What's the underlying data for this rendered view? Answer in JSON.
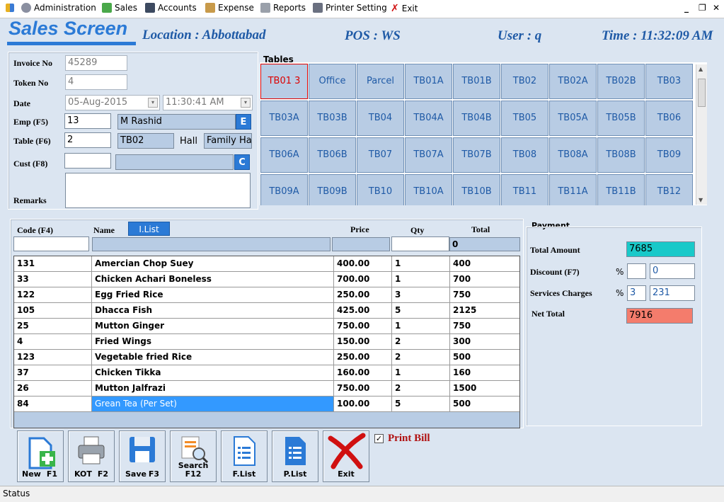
{
  "menu": {
    "administration": "Administration",
    "sales": "Sales",
    "accounts": "Accounts",
    "expense": "Expense",
    "reports": "Reports",
    "printer_setting": "Printer Setting",
    "exit": "Exit"
  },
  "header": {
    "title": "Sales Screen",
    "location": "Location : Abbottabad",
    "pos": "POS : WS",
    "user": "User : q",
    "time": "Time : 11:32:09 AM"
  },
  "form": {
    "invoice_label": "Invoice No",
    "invoice_value": "45289",
    "token_label": "Token No",
    "token_value": "4",
    "date_label": "Date",
    "date_value": "05-Aug-2015",
    "time_value": "11:30:41 AM",
    "emp_label": "Emp (F5)",
    "emp_code": "13",
    "emp_name": "M Rashid",
    "emp_btn": "E",
    "table_label": "Table (F6)",
    "table_code": "2",
    "table_name": "TB02",
    "hall_label": "Hall",
    "hall_value": "Family Ha",
    "cust_label": "Cust (F8)",
    "cust_code": "",
    "cust_name": "",
    "cust_btn": "C",
    "remarks_label": "Remarks",
    "remarks_value": ""
  },
  "tables": {
    "label": "Tables",
    "items": [
      "TB01  3",
      "Office",
      "Parcel",
      "TB01A",
      "TB01B",
      "TB02",
      "TB02A",
      "TB02B",
      "TB03",
      "TB03A",
      "TB03B",
      "TB04",
      "TB04A",
      "TB04B",
      "TB05",
      "TB05A",
      "TB05B",
      "TB06",
      "TB06A",
      "TB06B",
      "TB07",
      "TB07A",
      "TB07B",
      "TB08",
      "TB08A",
      "TB08B",
      "TB09",
      "TB09A",
      "TB09B",
      "TB10",
      "TB10A",
      "TB10B",
      "TB11",
      "TB11A",
      "TB11B",
      "TB12"
    ]
  },
  "grid": {
    "headers": {
      "code": "Code (F4)",
      "name": "Name",
      "ilist": "I.List",
      "price": "Price",
      "qty": "Qty",
      "total": "Total"
    },
    "entry_total": "0",
    "rows": [
      {
        "code": "131",
        "name": "Amercian Chop Suey",
        "price": "400.00",
        "qty": "1",
        "total": "400"
      },
      {
        "code": "33",
        "name": "Chicken Achari Boneless",
        "price": "700.00",
        "qty": "1",
        "total": "700"
      },
      {
        "code": "122",
        "name": "Egg Fried Rice",
        "price": "250.00",
        "qty": "3",
        "total": "750"
      },
      {
        "code": "105",
        "name": "Dhacca Fish",
        "price": "425.00",
        "qty": "5",
        "total": "2125"
      },
      {
        "code": "25",
        "name": "Mutton Ginger",
        "price": "750.00",
        "qty": "1",
        "total": "750"
      },
      {
        "code": "4",
        "name": "Fried Wings",
        "price": "150.00",
        "qty": "2",
        "total": "300"
      },
      {
        "code": "123",
        "name": "Vegetable fried Rice",
        "price": "250.00",
        "qty": "2",
        "total": "500"
      },
      {
        "code": "37",
        "name": "Chicken Tikka",
        "price": "160.00",
        "qty": "1",
        "total": "160"
      },
      {
        "code": "26",
        "name": "Mutton Jalfrazi",
        "price": "750.00",
        "qty": "2",
        "total": "1500"
      },
      {
        "code": "84",
        "name": "Grean Tea (Per Set)",
        "price": "100.00",
        "qty": "5",
        "total": "500"
      }
    ]
  },
  "payment": {
    "label": "Payment",
    "total_amount_label": "Total Amount",
    "total_amount": "7685",
    "discount_label": "Discount (F7)",
    "discount_pct_sign": "%",
    "discount_pct": "",
    "discount_value": "0",
    "services_label": "Services Charges",
    "services_pct_sign": "%",
    "services_pct": "3",
    "services_value": "231",
    "net_total_label": "Net Total",
    "net_total": "7916",
    "total_color": "#19c9c9",
    "net_color": "#f47c6c"
  },
  "buttons": {
    "new": "New",
    "new_key": "F1",
    "kot": "KOT",
    "kot_key": "F2",
    "save": "Save",
    "save_key": "F3",
    "search": "Search",
    "search_key": "F12",
    "flist": "F.List",
    "plist": "P.List",
    "exit": "Exit",
    "print_bill": "Print Bill"
  },
  "status": "Status"
}
